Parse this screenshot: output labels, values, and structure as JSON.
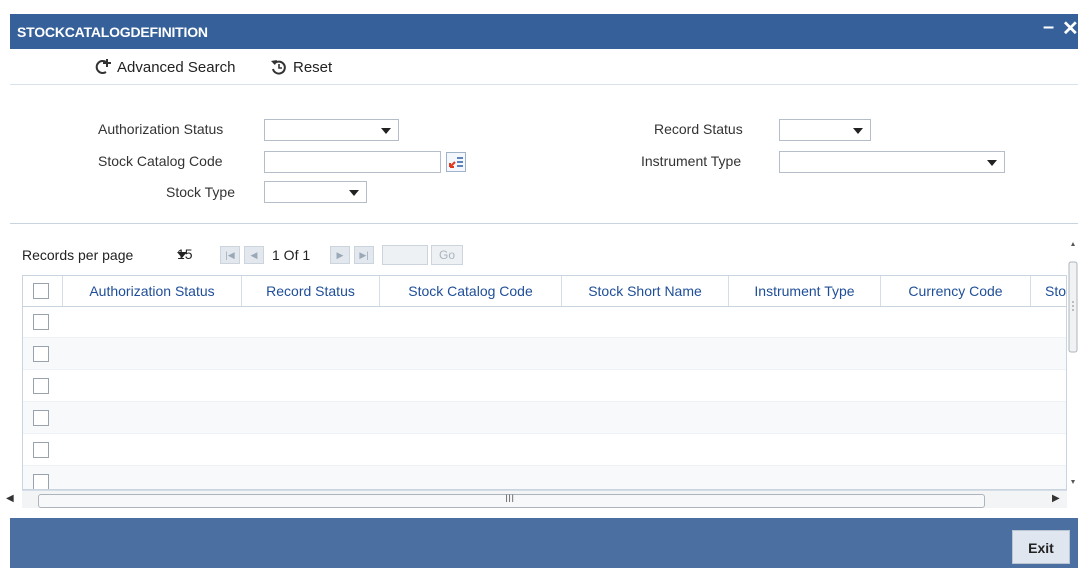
{
  "window": {
    "title": "STOCKCATALOGDEFINITION",
    "minimize": "–",
    "close": "✕"
  },
  "toolbar": {
    "advanced_search": "Advanced Search",
    "reset": "Reset"
  },
  "form": {
    "authorization_status_label": "Authorization Status",
    "authorization_status_value": "",
    "stock_catalog_code_label": "Stock Catalog Code",
    "stock_catalog_code_value": "",
    "stock_type_label": "Stock Type",
    "stock_type_value": "",
    "record_status_label": "Record Status",
    "record_status_value": "",
    "instrument_type_label": "Instrument Type",
    "instrument_type_value": ""
  },
  "pagination": {
    "records_per_page_label": "Records per page",
    "records_per_page_value": "15",
    "page_info": "1 Of 1",
    "page_input": "",
    "go_label": "Go"
  },
  "table": {
    "columns": [
      "Authorization Status",
      "Record Status",
      "Stock Catalog Code",
      "Stock Short Name",
      "Instrument Type",
      "Currency Code",
      "Sto"
    ],
    "row_count": 6
  },
  "scrollbar": {
    "thumb_label": "III"
  },
  "footer": {
    "exit_label": "Exit"
  },
  "colors": {
    "title_bar": "#35609a",
    "footer": "#4c6fa2",
    "header_text": "#1f4e98"
  }
}
